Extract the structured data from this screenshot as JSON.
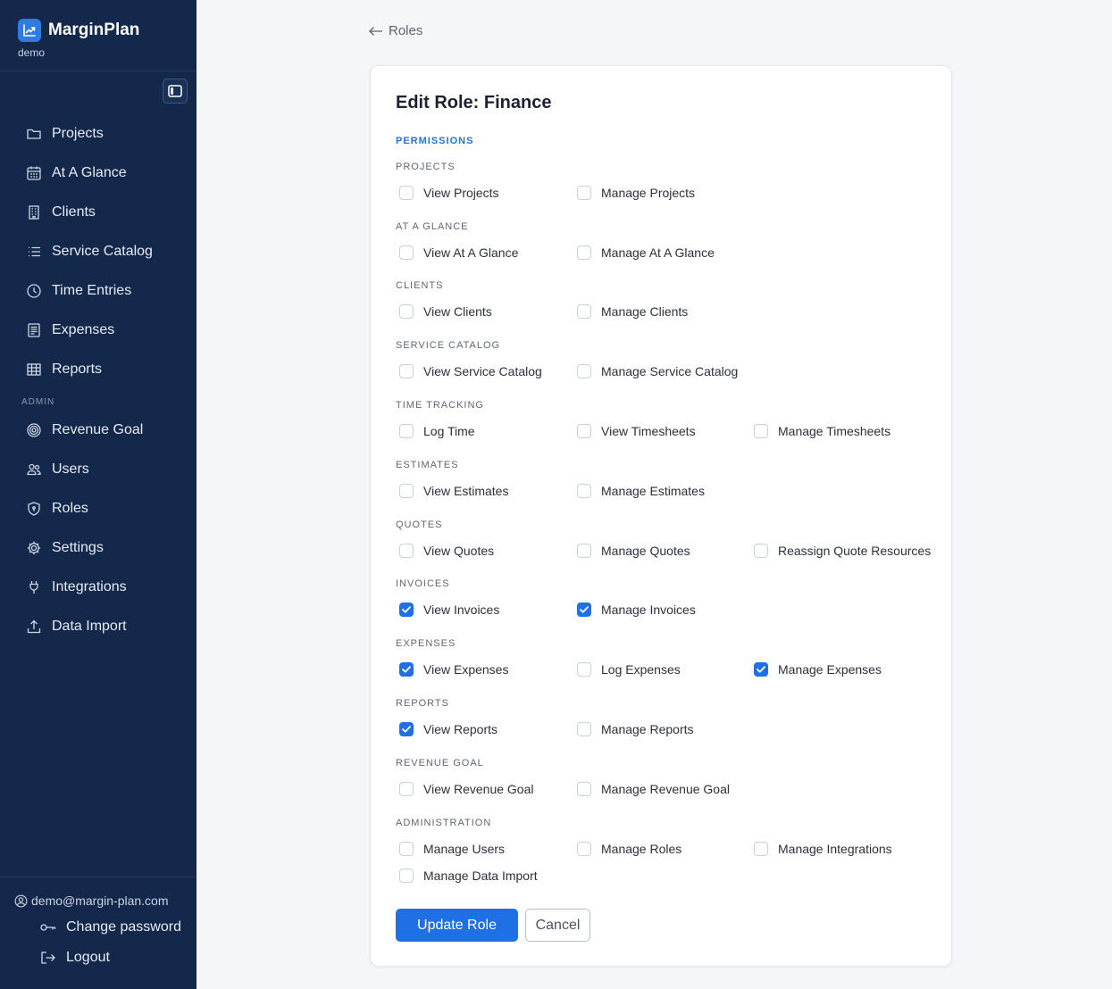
{
  "app": {
    "name": "MarginPlan",
    "workspace": "demo"
  },
  "sidebar": {
    "items": [
      {
        "label": "Projects",
        "icon": "folder-icon"
      },
      {
        "label": "At A Glance",
        "icon": "calendar-grid-icon"
      },
      {
        "label": "Clients",
        "icon": "building-icon"
      },
      {
        "label": "Service Catalog",
        "icon": "list-icon"
      },
      {
        "label": "Time Entries",
        "icon": "clock-icon"
      },
      {
        "label": "Expenses",
        "icon": "receipt-icon"
      },
      {
        "label": "Reports",
        "icon": "table-icon"
      }
    ],
    "admin_label": "ADMIN",
    "admin_items": [
      {
        "label": "Revenue Goal",
        "icon": "target-icon"
      },
      {
        "label": "Users",
        "icon": "users-icon"
      },
      {
        "label": "Roles",
        "icon": "shield-icon"
      },
      {
        "label": "Settings",
        "icon": "gear-icon"
      },
      {
        "label": "Integrations",
        "icon": "plug-icon"
      },
      {
        "label": "Data Import",
        "icon": "upload-icon"
      }
    ],
    "user_email": "demo@margin-plan.com",
    "change_password": "Change password",
    "logout": "Logout"
  },
  "main": {
    "back_label": "Roles",
    "title": "Edit Role: Finance",
    "permissions_heading": "PERMISSIONS",
    "groups": [
      {
        "label": "PROJECTS",
        "perms": [
          {
            "label": "View Projects",
            "checked": false
          },
          {
            "label": "Manage Projects",
            "checked": false
          }
        ]
      },
      {
        "label": "AT A GLANCE",
        "perms": [
          {
            "label": "View At A Glance",
            "checked": false
          },
          {
            "label": "Manage At A Glance",
            "checked": false
          }
        ]
      },
      {
        "label": "CLIENTS",
        "perms": [
          {
            "label": "View Clients",
            "checked": false
          },
          {
            "label": "Manage Clients",
            "checked": false
          }
        ]
      },
      {
        "label": "SERVICE CATALOG",
        "perms": [
          {
            "label": "View Service Catalog",
            "checked": false
          },
          {
            "label": "Manage Service Catalog",
            "checked": false
          }
        ]
      },
      {
        "label": "TIME TRACKING",
        "perms": [
          {
            "label": "Log Time",
            "checked": false
          },
          {
            "label": "View Timesheets",
            "checked": false
          },
          {
            "label": "Manage Timesheets",
            "checked": false
          }
        ]
      },
      {
        "label": "ESTIMATES",
        "perms": [
          {
            "label": "View Estimates",
            "checked": false
          },
          {
            "label": "Manage Estimates",
            "checked": false
          }
        ]
      },
      {
        "label": "QUOTES",
        "perms": [
          {
            "label": "View Quotes",
            "checked": false
          },
          {
            "label": "Manage Quotes",
            "checked": false
          },
          {
            "label": "Reassign Quote Resources",
            "checked": false
          }
        ]
      },
      {
        "label": "INVOICES",
        "perms": [
          {
            "label": "View Invoices",
            "checked": true
          },
          {
            "label": "Manage Invoices",
            "checked": true
          }
        ]
      },
      {
        "label": "EXPENSES",
        "perms": [
          {
            "label": "View Expenses",
            "checked": true
          },
          {
            "label": "Log Expenses",
            "checked": false
          },
          {
            "label": "Manage Expenses",
            "checked": true
          }
        ]
      },
      {
        "label": "REPORTS",
        "perms": [
          {
            "label": "View Reports",
            "checked": true
          },
          {
            "label": "Manage Reports",
            "checked": false
          }
        ]
      },
      {
        "label": "REVENUE GOAL",
        "perms": [
          {
            "label": "View Revenue Goal",
            "checked": false
          },
          {
            "label": "Manage Revenue Goal",
            "checked": false
          }
        ]
      },
      {
        "label": "ADMINISTRATION",
        "perms": [
          {
            "label": "Manage Users",
            "checked": false
          },
          {
            "label": "Manage Roles",
            "checked": false
          },
          {
            "label": "Manage Integrations",
            "checked": false
          },
          {
            "label": "Manage Data Import",
            "checked": false
          }
        ]
      }
    ],
    "submit_label": "Update Role",
    "cancel_label": "Cancel"
  },
  "colors": {
    "sidebar_bg": "#13284a",
    "accent": "#1f6fe5",
    "page_bg": "#f5f6f8"
  }
}
